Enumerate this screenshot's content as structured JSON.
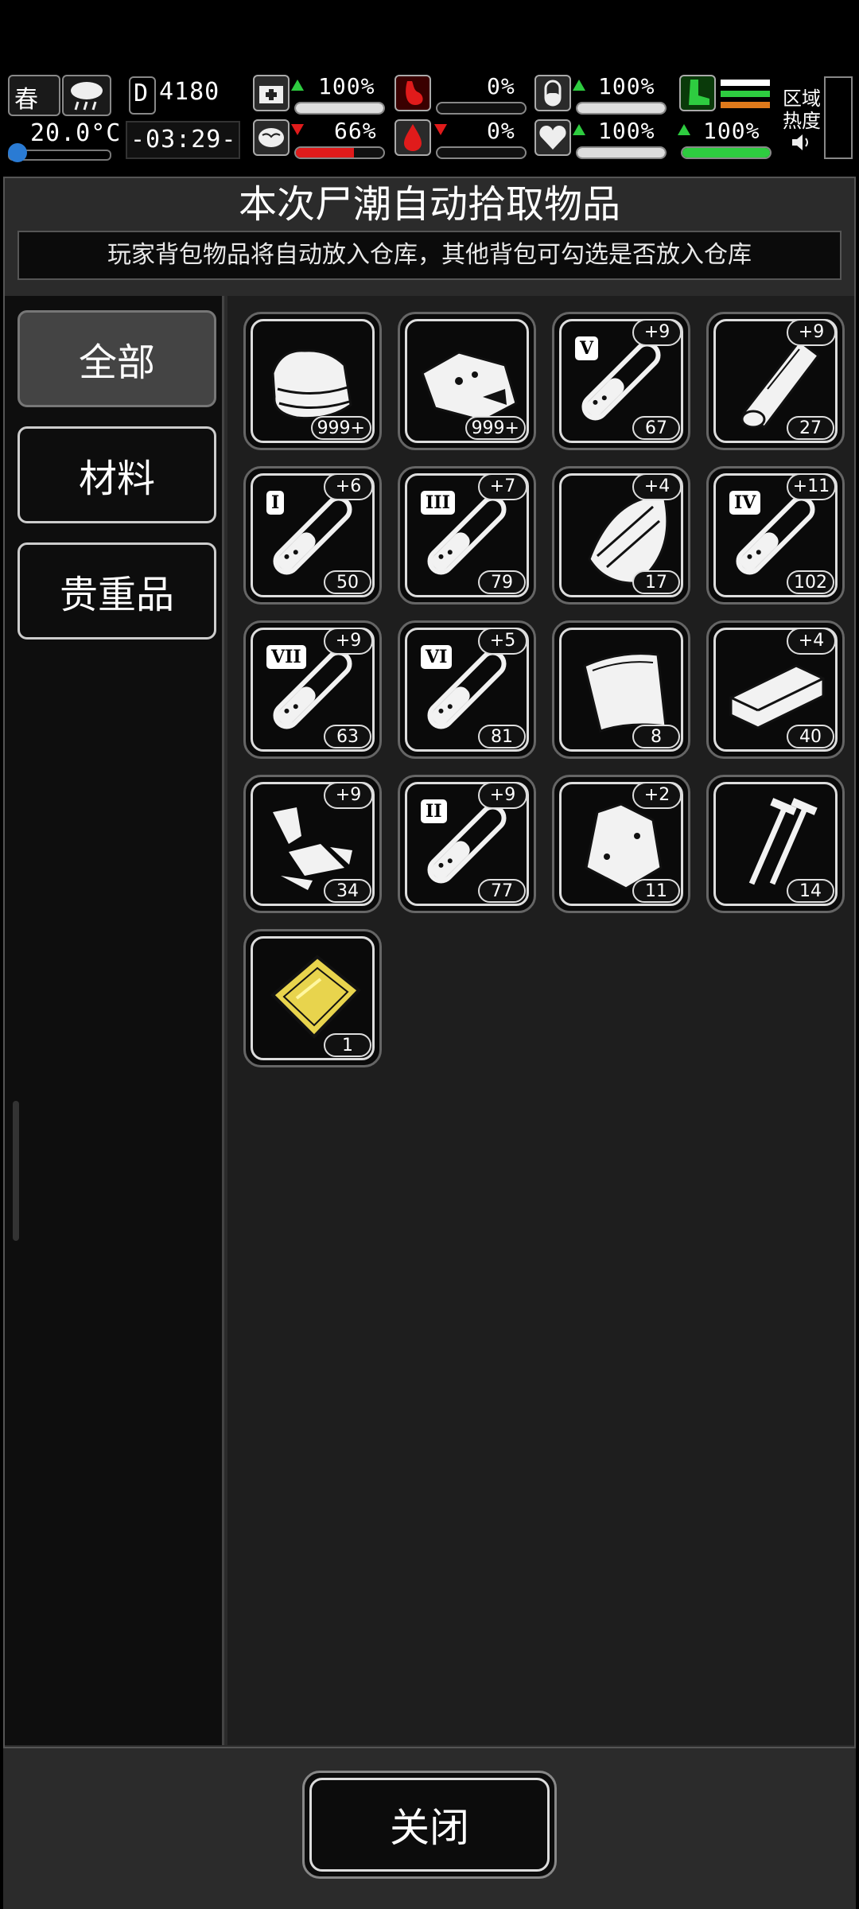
{
  "hud": {
    "season": "春",
    "temperature": "20.0°C",
    "money": "4180",
    "money_prefix": "D",
    "time": "-03:29-",
    "stats": [
      {
        "name": "health",
        "value": "100%",
        "trend": "up",
        "level": 1.0,
        "color": "#dddddd"
      },
      {
        "name": "hunger",
        "value": "0%",
        "trend": "none",
        "level": 0.0,
        "color": "#e01b1b"
      },
      {
        "name": "thirst",
        "value": "100%",
        "trend": "up",
        "level": 1.0,
        "color": "#dddddd"
      },
      {
        "name": "sanity",
        "value": "66%",
        "trend": "down",
        "level": 0.66,
        "color": "#e01b1b"
      },
      {
        "name": "bleeding",
        "value": "0%",
        "trend": "down",
        "level": 0.0,
        "color": "#e01b1b"
      },
      {
        "name": "mood",
        "value": "100%",
        "trend": "up",
        "level": 1.0,
        "color": "#dddddd"
      },
      {
        "name": "stamina",
        "value": "100%",
        "trend": "up",
        "level": 1.0,
        "color": "#2ecc40"
      }
    ],
    "zone_label_1": "区域",
    "zone_label_2": "热度"
  },
  "dialog": {
    "title": "本次尸潮自动拾取物品",
    "subtitle": "玩家背包物品将自动放入仓库，其他背包可勾选是否放入仓库"
  },
  "tabs": [
    {
      "label": "全部",
      "active": true
    },
    {
      "label": "材料",
      "active": false
    },
    {
      "label": "贵重品",
      "active": false
    }
  ],
  "items": [
    {
      "icon": "cloth-icon",
      "count": "999+",
      "bonus": ""
    },
    {
      "icon": "meat-icon",
      "count": "999+",
      "bonus": ""
    },
    {
      "icon": "test-tube-icon",
      "roman": "V",
      "count": "67",
      "bonus": "+9"
    },
    {
      "icon": "wood-log-icon",
      "count": "27",
      "bonus": "+9"
    },
    {
      "icon": "test-tube-icon",
      "roman": "I",
      "count": "50",
      "bonus": "+6"
    },
    {
      "icon": "test-tube-icon",
      "roman": "III",
      "count": "79",
      "bonus": "+7"
    },
    {
      "icon": "bark-icon",
      "count": "17",
      "bonus": "+4"
    },
    {
      "icon": "test-tube-icon",
      "roman": "IV",
      "count": "102",
      "bonus": "+11"
    },
    {
      "icon": "test-tube-icon",
      "roman": "VII",
      "count": "63",
      "bonus": "+9"
    },
    {
      "icon": "test-tube-icon",
      "roman": "VI",
      "count": "81",
      "bonus": "+5"
    },
    {
      "icon": "leather-icon",
      "count": "8",
      "bonus": ""
    },
    {
      "icon": "plank-icon",
      "count": "40",
      "bonus": "+4"
    },
    {
      "icon": "scrap-icon",
      "count": "34",
      "bonus": "+9"
    },
    {
      "icon": "test-tube-icon",
      "roman": "II",
      "count": "77",
      "bonus": "+9"
    },
    {
      "icon": "pouch-icon",
      "count": "11",
      "bonus": "+2"
    },
    {
      "icon": "nails-icon",
      "count": "14",
      "bonus": ""
    },
    {
      "icon": "gold-card-icon",
      "count": "1",
      "bonus": ""
    }
  ],
  "close_label": "关闭",
  "colors": {
    "accent_green": "#2ecc40",
    "alert_red": "#e01b1b",
    "gold": "#e8d44d"
  }
}
